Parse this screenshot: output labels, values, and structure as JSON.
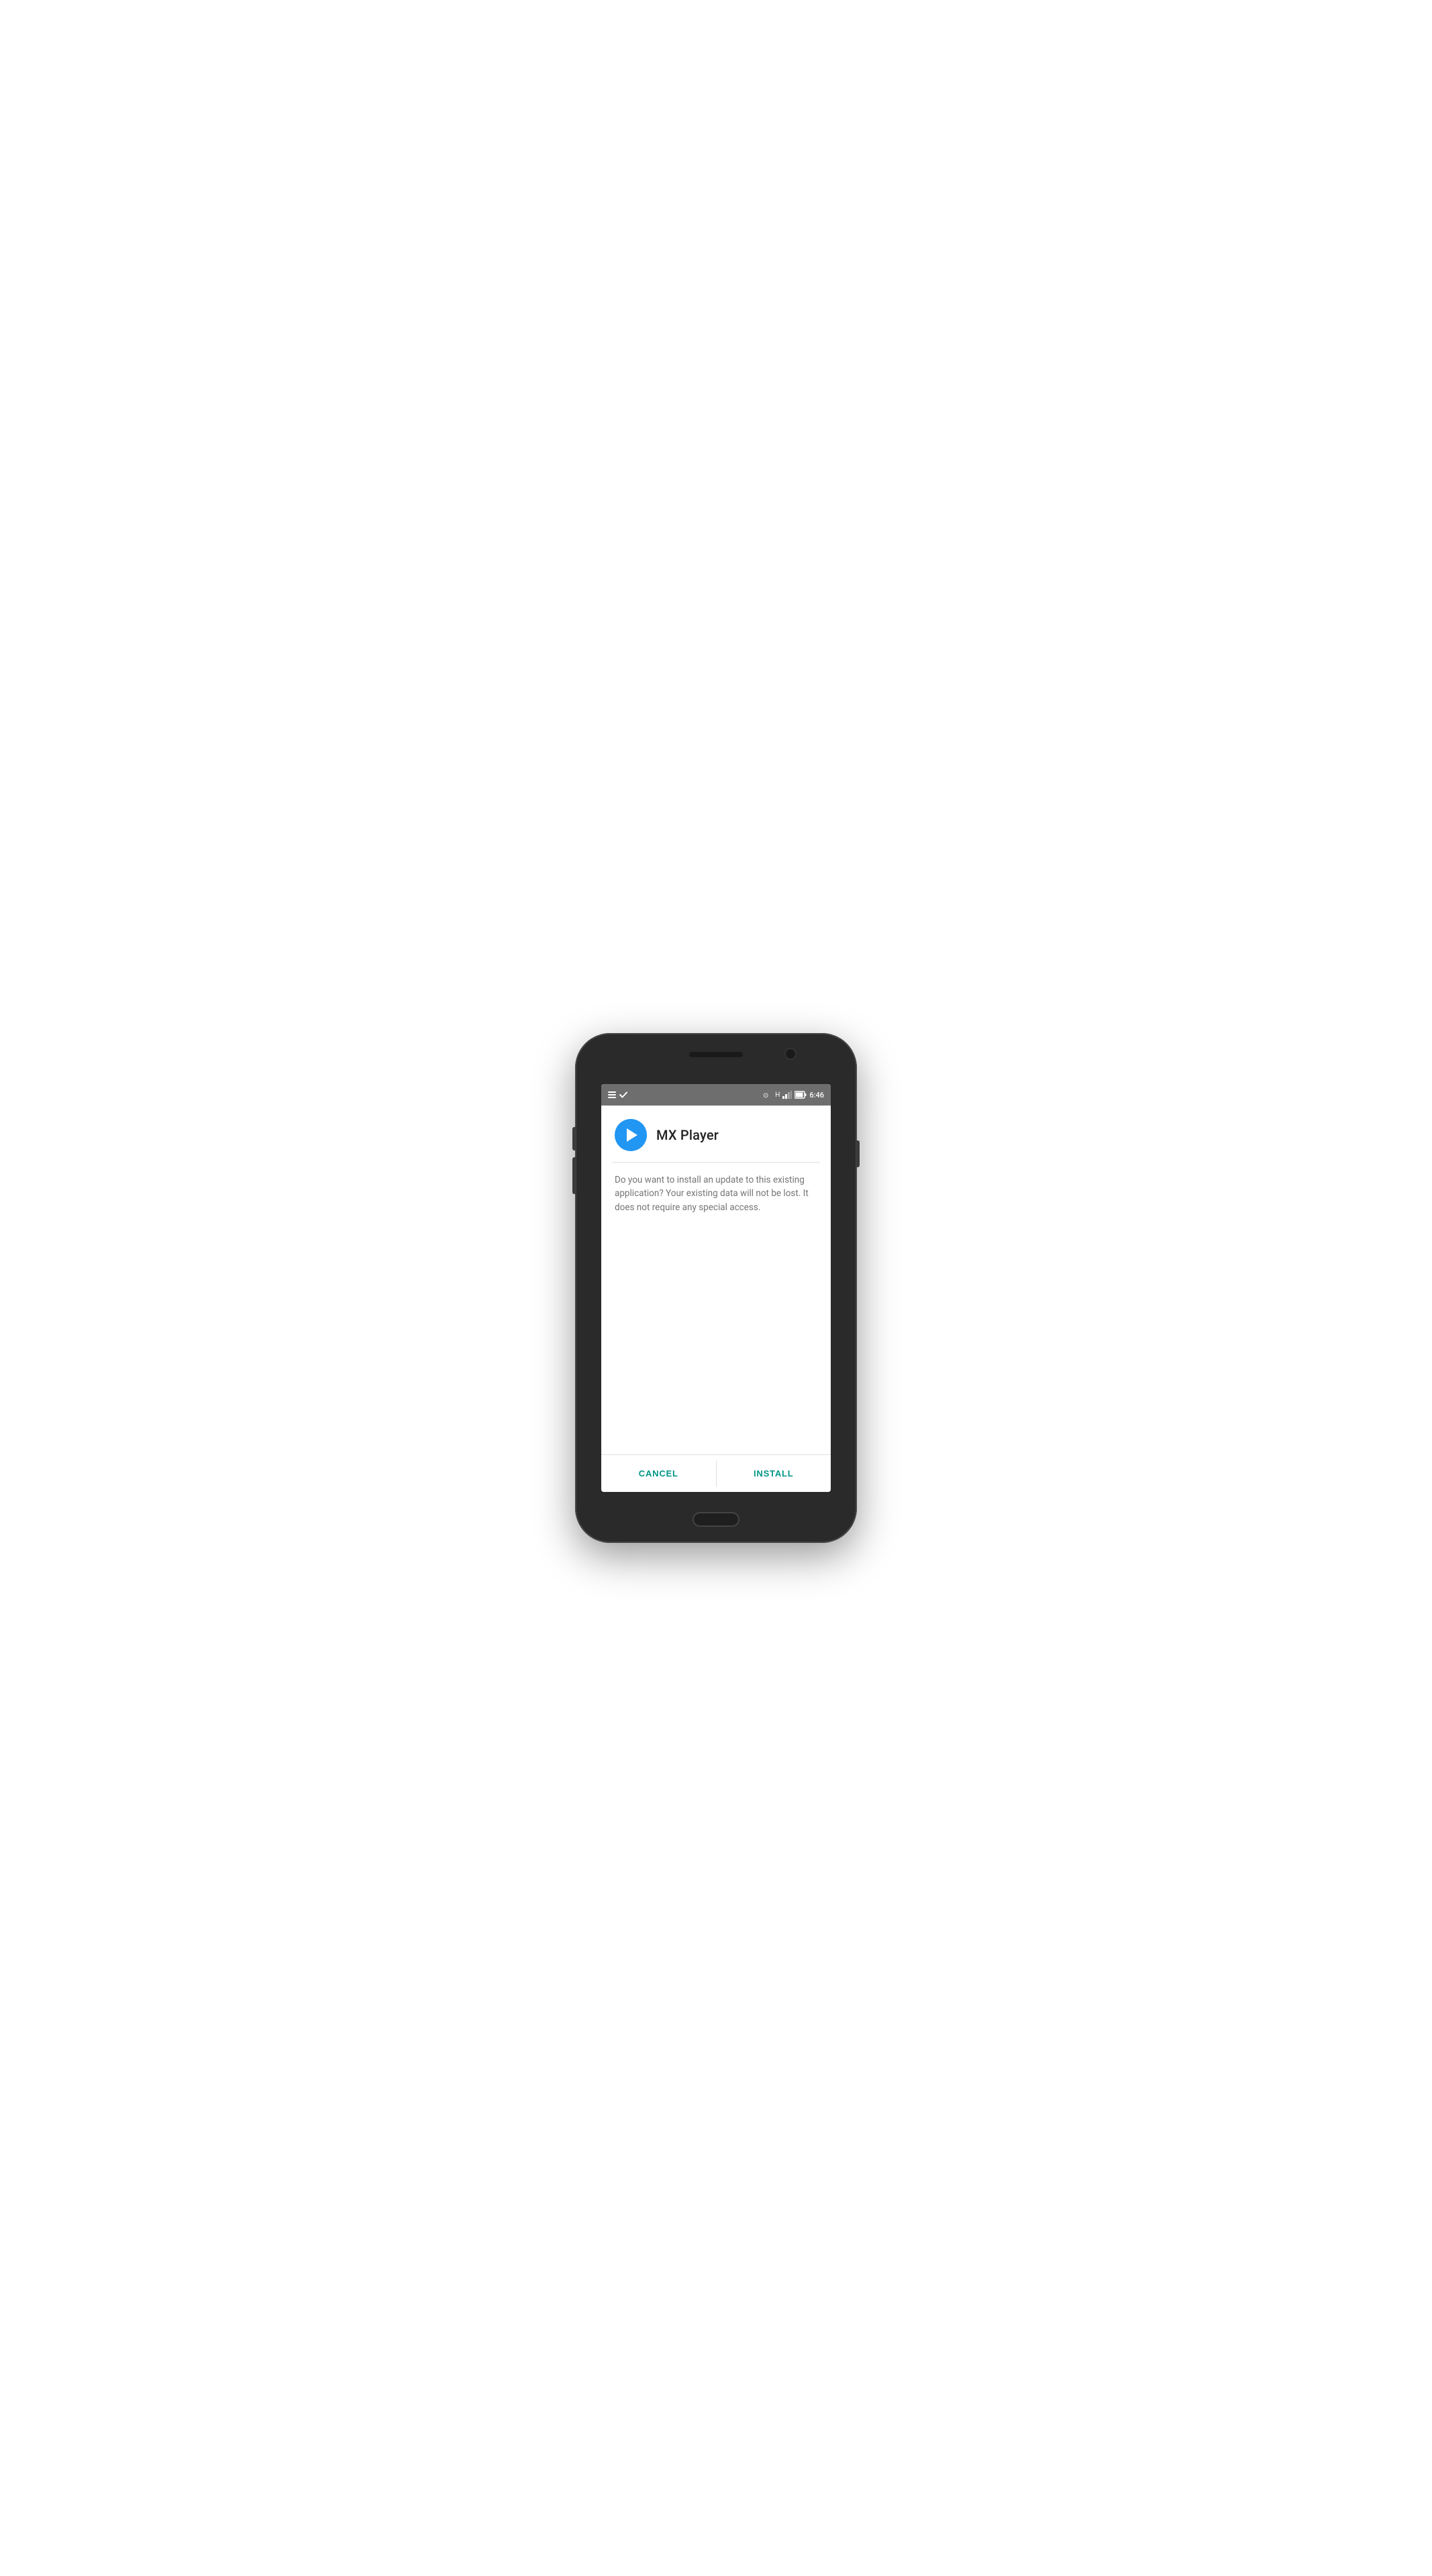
{
  "phone": {
    "status_bar": {
      "time": "6:46",
      "left_icons": [
        "menu-icon",
        "check-icon"
      ],
      "right_icons": [
        "wifi-icon",
        "h-icon",
        "signal-icon",
        "battery-icon"
      ]
    }
  },
  "dialog": {
    "app_name": "MX Player",
    "message": "Do you want to install an update to this existing application? Your existing data will not be lost. It does not require any special access.",
    "cancel_label": "CANCEL",
    "install_label": "INSTALL"
  }
}
